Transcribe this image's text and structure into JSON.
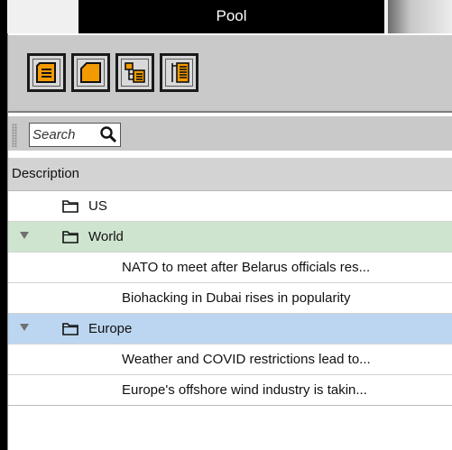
{
  "window": {
    "title": "Pool"
  },
  "toolbar": {
    "buttons": [
      {
        "icon": "document-list-icon"
      },
      {
        "icon": "folder-icon"
      },
      {
        "icon": "tree-view-icon"
      },
      {
        "icon": "nested-tree-icon"
      }
    ]
  },
  "search": {
    "placeholder": "Search",
    "icon": "search-icon"
  },
  "table": {
    "header": "Description",
    "rows": [
      {
        "label": "US",
        "type": "folder",
        "expanded": false
      },
      {
        "label": "World",
        "type": "folder",
        "expanded": true,
        "color": "#cfe4cf"
      },
      {
        "label": "NATO to meet after Belarus officials res...",
        "type": "article"
      },
      {
        "label": "Biohacking in Dubai rises in popularity",
        "type": "article"
      },
      {
        "label": "Europe",
        "type": "folder",
        "expanded": true,
        "color": "#bcd6f1"
      },
      {
        "label": "Weather and COVID restrictions lead to...",
        "type": "article"
      },
      {
        "label": "Europe's offshore wind industry is takin...",
        "type": "article"
      }
    ]
  }
}
